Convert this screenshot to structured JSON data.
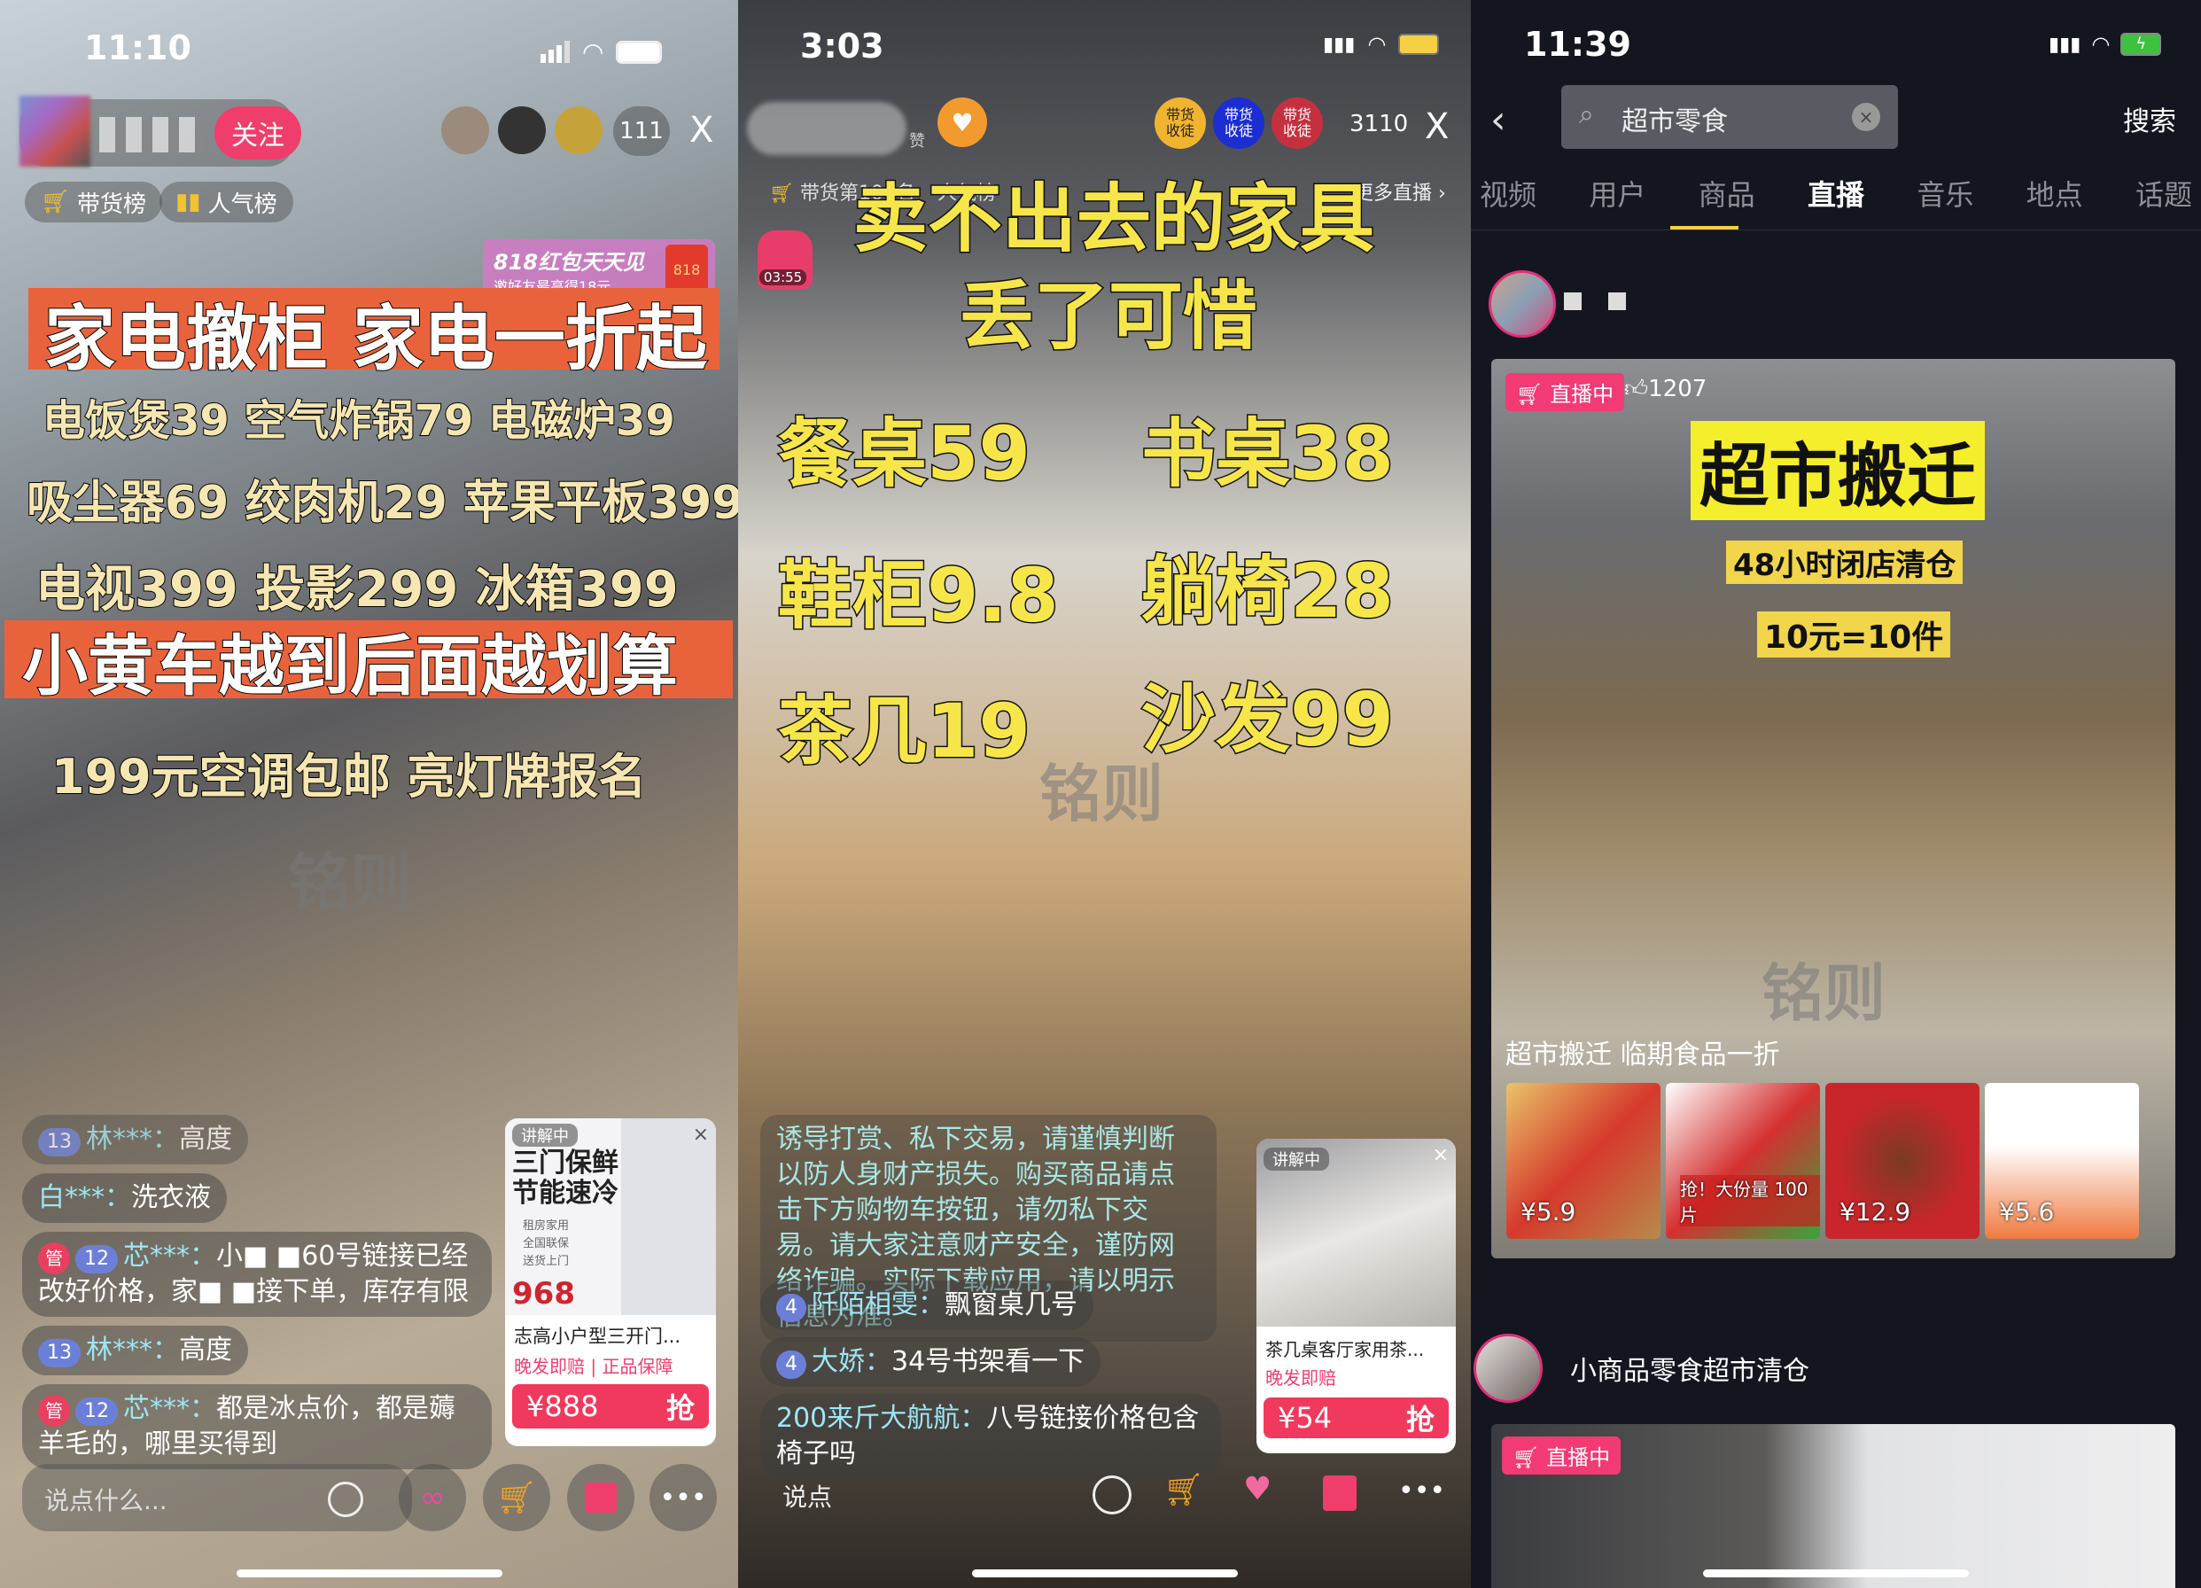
{
  "watermark": "铭则",
  "left": {
    "time": "11:10",
    "follow": "关注",
    "viewer_count": "111",
    "close": "X",
    "rank_sales": "带货榜",
    "rank_popular": "人气榜",
    "banner": {
      "title": "818红包天天见",
      "sub": "邀好友最高得18元",
      "badge": "818"
    },
    "headline1": "家电撤柜 家电一折起",
    "line2": "电饭煲39 空气炸锅79 电磁炉39",
    "line3": "吸尘器69 绞肉机29 苹果平板399",
    "line4": "电视399 投影299 冰箱399",
    "headline2": "小黄车越到后面越划算",
    "line5": "199元空调包邮 亮灯牌报名",
    "comments": [
      {
        "level": "13",
        "user": "林***：",
        "text": "高度"
      },
      {
        "user": "白***：",
        "text": "洗衣液"
      },
      {
        "badge": "管",
        "level": "12",
        "user": "芯***：",
        "text": "小■ ■60号链接已经改好价格，家■ ■接下单，库存有限"
      },
      {
        "level": "13",
        "user": "林***：",
        "text": "高度"
      },
      {
        "badge": "管",
        "level": "12",
        "user": "芯***：",
        "text": "都是冰点价，都是薅羊毛的，哪里买得到"
      }
    ],
    "product": {
      "status": "讲解中",
      "img_title1": "三门保鲜",
      "img_title2": "节能速冷",
      "features": [
        "租房家用",
        "全国联保",
        "送货上门"
      ],
      "img_price": "968",
      "name": "志高小户型三开门...",
      "tag1": "晚发即赔",
      "tag2": "正品保障",
      "price": "¥888",
      "buy": "抢"
    },
    "input_placeholder": "说点什么..."
  },
  "middle": {
    "time": "3:03",
    "liker_suffix": "赞",
    "badges": [
      "带货\n收徒",
      "带货\n收徒",
      "带货\n收徒"
    ],
    "viewer_count": "3110",
    "close": "X",
    "rank_sales": "带货第100名",
    "rank_popular": "人气榜",
    "more_live": "更多直播 ›",
    "timer": "03:55",
    "title1": "卖不出去的家具",
    "title2": "丢了可惜",
    "items": [
      "餐桌59",
      "书桌38",
      "鞋柜9.8",
      "躺椅28",
      "茶几19",
      "沙发99"
    ],
    "system_msg": "诱导打赏、私下交易，请谨慎判断以防人身财产损失。购买商品请点击下方购物车按钮，请勿私下交易。请大家注意财产安全，谨防网络诈骗。实际下载应用，请以明示信息为准。",
    "comments": [
      {
        "level": "4",
        "user": "阡陌相雯：",
        "text": "飘窗桌几号"
      },
      {
        "level": "4",
        "user": "大娇：",
        "text": "34号书架看一下"
      },
      {
        "user": "200来斤大航航：",
        "text": "八号链接价格包含椅子吗"
      }
    ],
    "product": {
      "status": "讲解中",
      "name": "茶几桌客厅家用茶...",
      "tag1": "晚发即赔",
      "price": "¥54",
      "buy": "抢"
    },
    "input_placeholder": "说点"
  },
  "right": {
    "time": "11:39",
    "search_query": "超市零食",
    "search_button": "搜索",
    "tabs": [
      "视频",
      "用户",
      "商品",
      "直播",
      "音乐",
      "地点",
      "话题"
    ],
    "active_tab": "直播",
    "card1": {
      "live_badge": "直播中",
      "likes": "1207",
      "sign": "超市搬迁",
      "banner1": "48小时闭店清仓",
      "banner2": "10元=10件",
      "caption": "超市搬迁 临期食品一折",
      "prices": [
        "¥5.9",
        "",
        "¥12.9",
        "¥5.6"
      ],
      "thumb2_text": "抢！大份量 100片"
    },
    "user2": "小商品零食超市清仓",
    "card2": {
      "live_badge": "直播中"
    },
    "accent": "#f5d045",
    "live_color": "#f23a74"
  }
}
